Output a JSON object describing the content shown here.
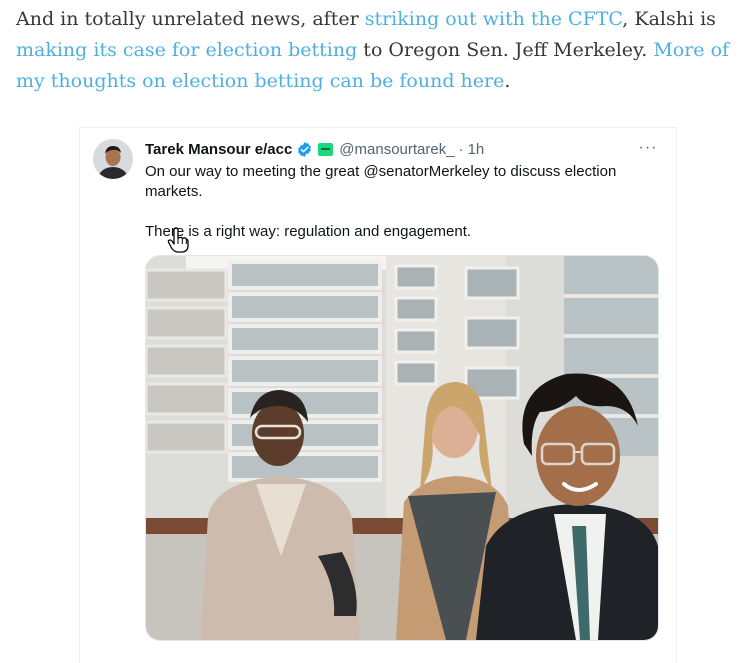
{
  "article": {
    "t1": "And in totally unrelated news, after ",
    "link1": "striking out with the CFTC",
    "t2": ", Kalshi is ",
    "link2": "making its case for election betting",
    "t3": " to Oregon Sen. Jeff Merkeley. ",
    "link3": "More of my thoughts on election betting can be found here",
    "t4": "."
  },
  "tweet": {
    "author_name": "Tarek Mansour e/acc",
    "handle": "@mansourtarek_",
    "separator": "·",
    "time": "1h",
    "more_label": "···",
    "text_line1": "On our way to meeting the great @senatorMerkeley to discuss election markets.",
    "text_line2": "There is a right way: regulation and engagement."
  },
  "icons": {
    "verified": "verified-badge-icon",
    "affiliation": "affiliate-badge-icon",
    "more": "more-options-icon",
    "cursor": "hand-pointer-cursor-icon"
  },
  "colors": {
    "link": "#4fb0de",
    "body_text": "#363737",
    "tweet_text": "#0f1419",
    "muted": "#536471",
    "verified_blue": "#1d9bf0",
    "affiliate_green": "#1bd87c"
  }
}
